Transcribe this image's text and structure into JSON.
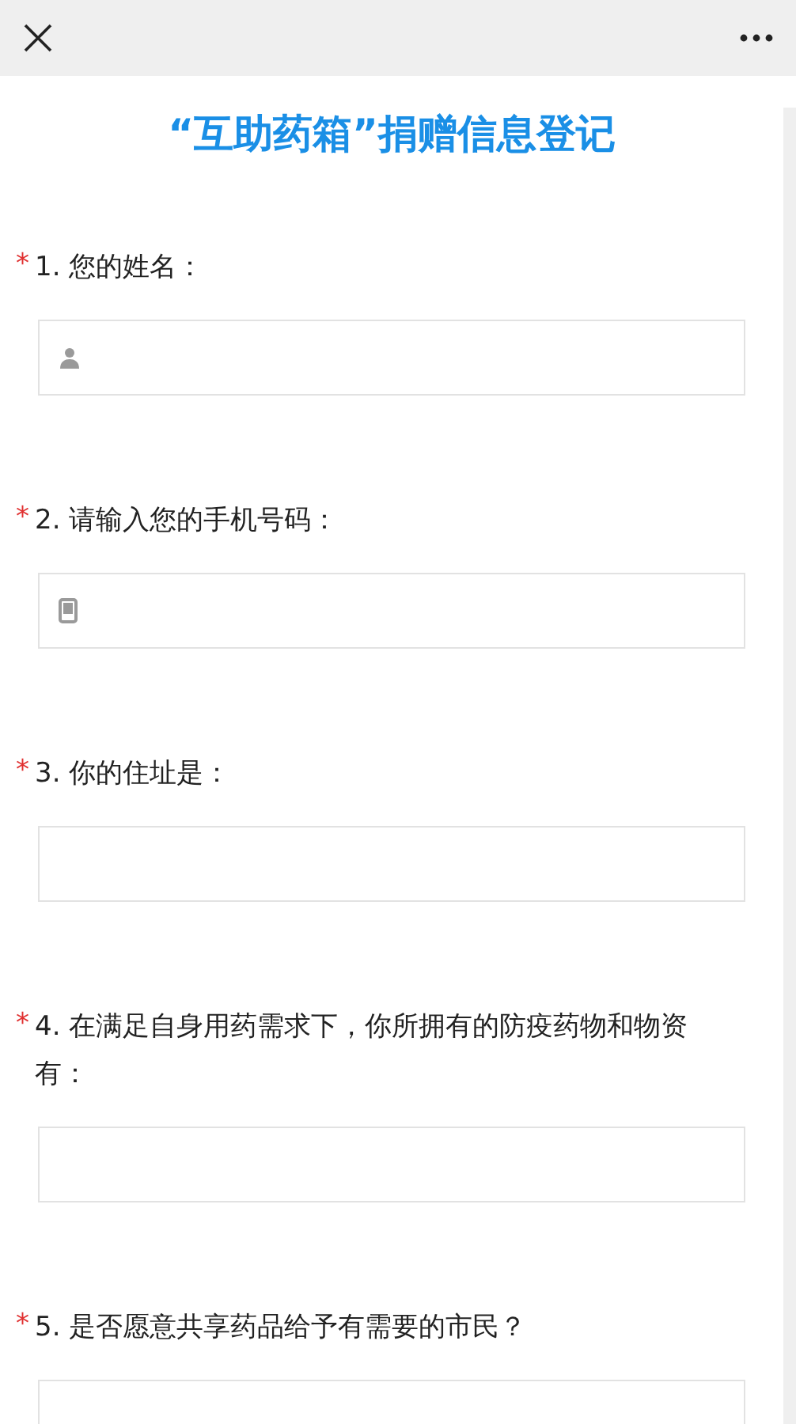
{
  "title": "“互助药箱”捐赠信息登记",
  "questions": [
    {
      "mark": "*",
      "label": "1. 您的姓名：",
      "kind": "name"
    },
    {
      "mark": "*",
      "label": "2. 请输入您的手机号码：",
      "kind": "phone"
    },
    {
      "mark": "*",
      "label": "3. 你的住址是：",
      "kind": "text"
    },
    {
      "mark": "*",
      "label": "4. 在满足自身用药需求下，你所拥有的防疫药物和物资有：",
      "kind": "text"
    },
    {
      "mark": "*",
      "label": "5. 是否愿意共享药品给予有需要的市民？",
      "kind": "text"
    }
  ]
}
